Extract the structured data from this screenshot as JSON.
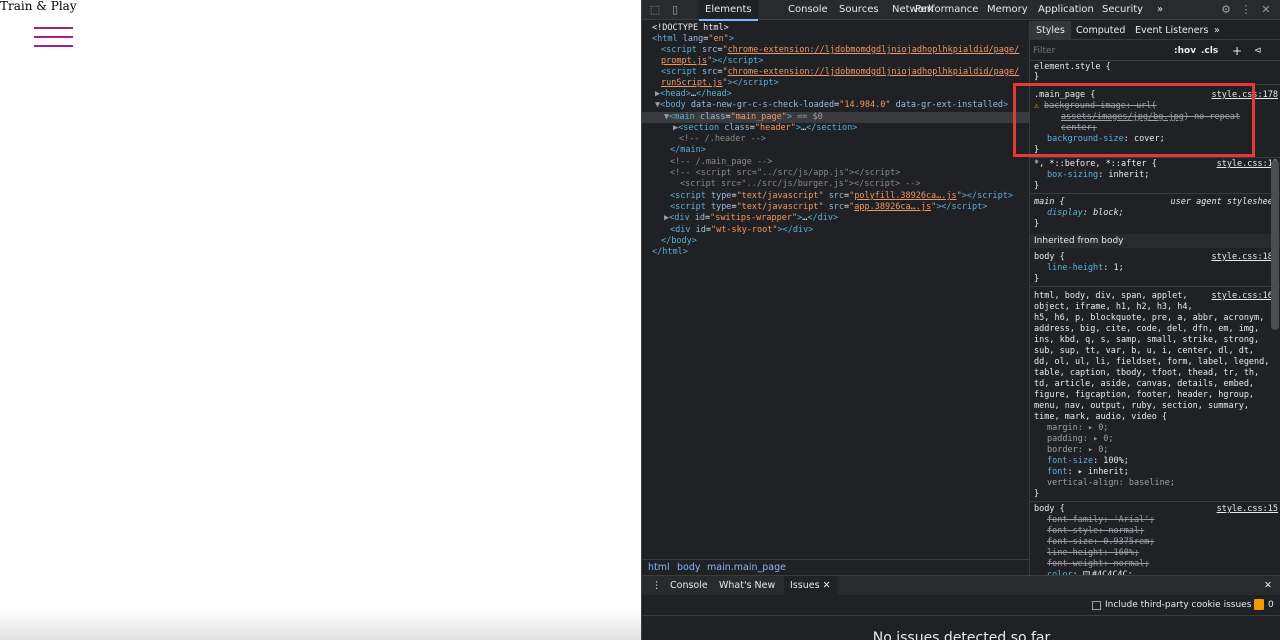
{
  "page": {
    "title": "Train & Play"
  },
  "devtools": {
    "tabs": [
      "Elements",
      "Console",
      "Sources",
      "Network",
      "Performance",
      "Memory",
      "Application",
      "Security"
    ],
    "more_tabs": "»",
    "dom": [
      {
        "html": "<span class='p'>&lt;!DOCTYPE html&gt;</span>"
      },
      {
        "html": "<span class='t'>&lt;html</span> <span class='a'>lang</span><span class='p'>=</span><span class='v'>\"en\"</span><span class='t'>&gt;</span>"
      },
      {
        "html": "<span class='t'>&lt;script</span> <span class='a'>src</span><span class='p'>=</span><span class='v'>\"</span><span class='l'>chrome-extension://ljdobmomdgdljniojadhoplhkpialdid/page/</span>"
      },
      {
        "html": "<span class='l'>prompt.js</span><span class='v'>\"</span><span class='t'>&gt;&lt;/script&gt;</span>"
      },
      {
        "html": "<span class='t'>&lt;script</span> <span class='a'>src</span><span class='p'>=</span><span class='v'>\"</span><span class='l'>chrome-extension://ljdobmomdgdljniojadhoplhkpialdid/page/</span>"
      },
      {
        "html": "<span class='l'>runScript.js</span><span class='v'>\"</span><span class='t'>&gt;&lt;/script&gt;</span>"
      },
      {
        "html": "<span class='tri'>▶</span><span class='t'>&lt;head&gt;</span><span class='p'>…</span><span class='t'>&lt;/head&gt;</span>"
      },
      {
        "html": "<span class='tri'>▼</span><span class='t'>&lt;body</span> <span class='a'>data-new-gr-c-s-check-loaded</span><span class='p'>=</span><span class='v'>\"14.984.0\"</span> <span class='a'>data-gr-ext-installed</span><span class='t'>&gt;</span>"
      },
      {
        "html": "<span class='tri'>▼</span><span class='t'>&lt;main</span> <span class='a'>class</span><span class='p'>=</span><span class='v'>\"main_page\"</span><span class='t'>&gt;</span> <span class='dim'>== $0</span>"
      },
      {
        "html": "<span class='tri'>▶</span><span class='t'>&lt;section</span> <span class='a'>class</span><span class='p'>=</span><span class='v'>\"header\"</span><span class='t'>&gt;</span><span class='p'>…</span><span class='t'>&lt;/section&gt;</span>"
      },
      {
        "html": "<span class='c'>&lt;!-- /.header --&gt;</span>"
      },
      {
        "html": "<span class='t'>&lt;/main&gt;</span>"
      },
      {
        "html": "<span class='c'>&lt;!-- /.main_page --&gt;</span>"
      },
      {
        "html": "<span class='c'>&lt;!-- &lt;script src=\"../src/js/app.js\"&gt;&lt;/script&gt;</span>"
      },
      {
        "html": "<span class='c'>&lt;script src=\"../src/js/burger.js\"&gt;&lt;/script&gt; --&gt;</span>"
      },
      {
        "html": "<span class='t'>&lt;script</span> <span class='a'>type</span><span class='p'>=</span><span class='v'>\"text/javascript\"</span> <span class='a'>src</span><span class='p'>=</span><span class='v'>\"</span><span class='l'>polyfill.38926ca….js</span><span class='v'>\"</span><span class='t'>&gt;&lt;/script&gt;</span>"
      },
      {
        "html": "<span class='t'>&lt;script</span> <span class='a'>type</span><span class='p'>=</span><span class='v'>\"text/javascript\"</span> <span class='a'>src</span><span class='p'>=</span><span class='v'>\"</span><span class='l'>app.38926ca….js</span><span class='v'>\"</span><span class='t'>&gt;&lt;/script&gt;</span>"
      },
      {
        "html": "<span class='tri'>▶</span><span class='t'>&lt;div</span> <span class='a'>id</span><span class='p'>=</span><span class='v'>\"switips-wrapper\"</span><span class='t'>&gt;</span><span class='p'>…</span><span class='t'>&lt;/div&gt;</span>"
      },
      {
        "html": "<span class='t'>&lt;div</span> <span class='a'>id</span><span class='p'>=</span><span class='v'>\"wt-sky-root\"</span><span class='t'>&gt;&lt;/div&gt;</span>"
      },
      {
        "html": "<span class='t'>&lt;/body&gt;</span>"
      },
      {
        "html": "<span class='t'>&lt;/html&gt;</span>"
      }
    ],
    "breadcrumbs": [
      "html",
      "body",
      "main.main_page"
    ],
    "styles_tabs": [
      "Styles",
      "Computed",
      "Event Listeners"
    ],
    "styles_more": "»",
    "filter_placeholder": "Filter",
    "hov": ":hov",
    "cls": ".cls",
    "plus": "+",
    "inherited_from": "Inherited from body",
    "drawer_tabs": [
      "Console",
      "What's New",
      "Issues"
    ],
    "include_third_party": "Include third-party cookie issues",
    "issues_count": "0",
    "no_issues": "No issues detected so far"
  },
  "colors": {
    "burger": "#a3208c",
    "highlight": "#e53935"
  }
}
